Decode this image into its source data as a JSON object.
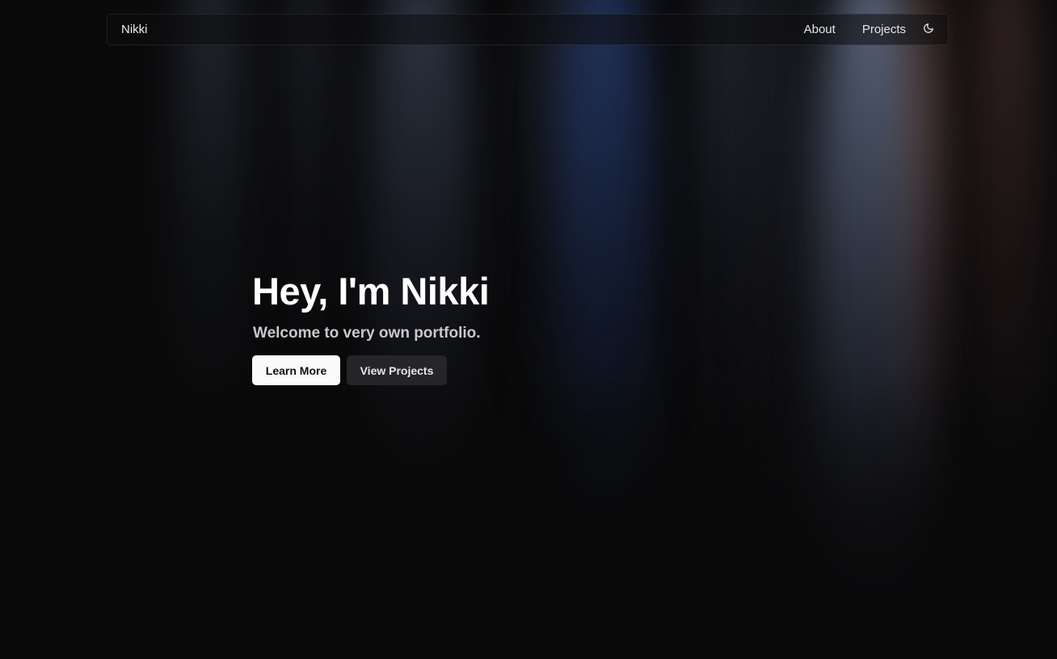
{
  "navbar": {
    "brand": "Nikki",
    "links": [
      {
        "label": "About"
      },
      {
        "label": "Projects"
      }
    ],
    "theme_toggle_icon": "moon-icon"
  },
  "hero": {
    "title": "Hey, I'm Nikki",
    "subtitle": "Welcome to very own portfolio.",
    "primary_button": "Learn More",
    "secondary_button": "View Projects"
  },
  "colors": {
    "background": "#0a0a0b",
    "primary_button_bg": "#fafafa",
    "secondary_button_bg": "#28282c",
    "subtitle_text": "#c9c9cc"
  }
}
